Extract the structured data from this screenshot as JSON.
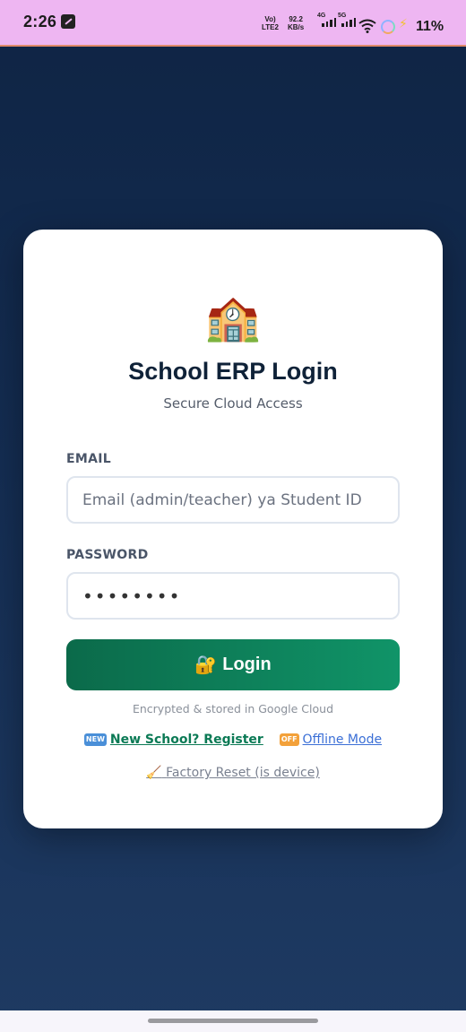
{
  "status_bar": {
    "time": "2:26",
    "volte_top": "Vo)",
    "volte_bottom": "LTE2",
    "speed_value": "92.2",
    "speed_unit": "KB/s",
    "net1": "4G",
    "net2": "5G",
    "battery": "11%"
  },
  "login": {
    "logo_emoji": "🏫",
    "title": "School ERP Login",
    "subtitle": "Secure Cloud Access",
    "email_label": "EMAIL",
    "email_placeholder": "Email (admin/teacher) ya Student ID",
    "password_label": "PASSWORD",
    "password_value": "••••••••",
    "login_emoji": "🔐",
    "login_button": "Login",
    "note": "Encrypted & stored in Google Cloud",
    "new_badge": "NEW",
    "register_link": "New School? Register",
    "offline_badge": "OFF",
    "offline_link": "Offline Mode",
    "reset_emoji": "🧹",
    "reset_link": "Factory Reset (is device)"
  },
  "colors": {
    "background": "#142d52",
    "accent_green": "#0b7a55",
    "link_blue": "#3b6fd6",
    "status_bar": "#eeb6f2"
  }
}
